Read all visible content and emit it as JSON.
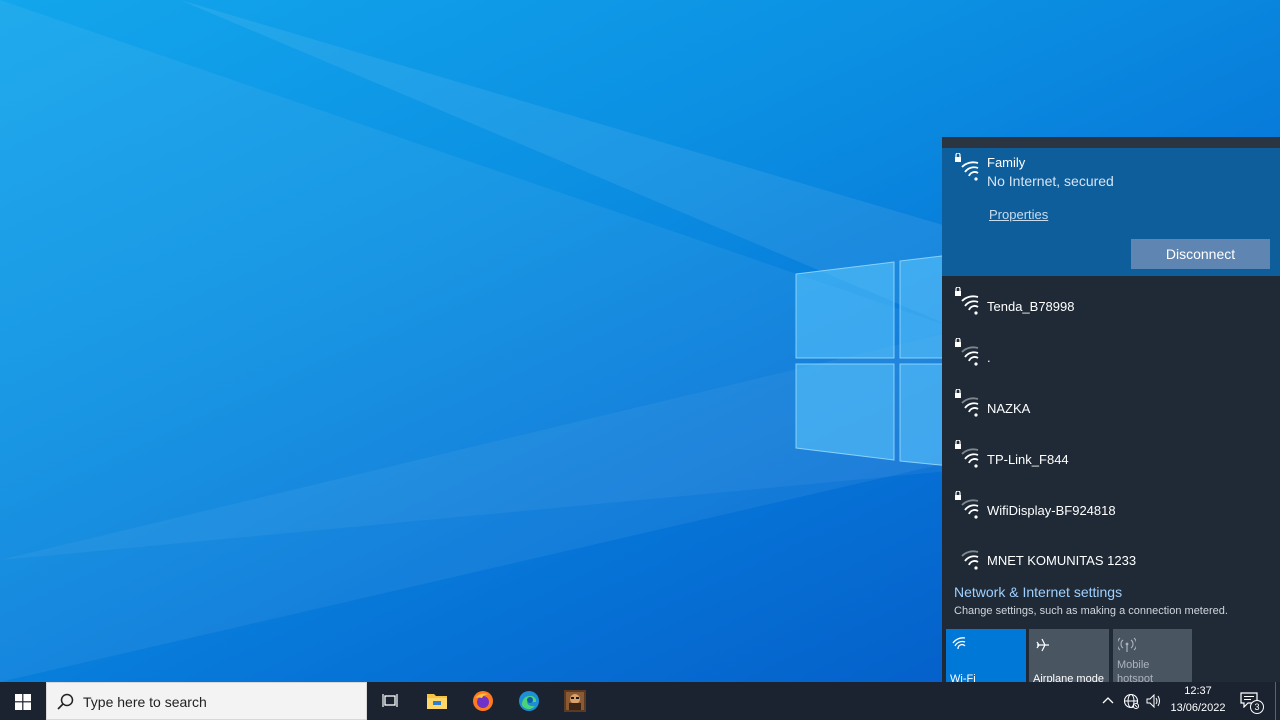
{
  "flyout": {
    "connected": {
      "name": "Family",
      "status": "No Internet, secured",
      "properties_label": "Properties",
      "disconnect_label": "Disconnect"
    },
    "networks": [
      {
        "name": "Tenda_B78998",
        "secured": true
      },
      {
        "name": ".",
        "secured": true
      },
      {
        "name": "NAZKA",
        "secured": true
      },
      {
        "name": "TP-Link_F844",
        "secured": true
      },
      {
        "name": "WifiDisplay-BF924818",
        "secured": true
      },
      {
        "name": "MNET KOMUNITAS 1233",
        "secured": false
      }
    ],
    "settings_link": "Network & Internet settings",
    "settings_desc": "Change settings, such as making a connection metered.",
    "quick_actions": [
      {
        "label": "Wi-Fi",
        "icon": "wifi-icon",
        "state": "on"
      },
      {
        "label": "Airplane mode",
        "icon": "airplane-icon",
        "state": "off"
      },
      {
        "label": "Mobile hotspot",
        "icon": "hotspot-icon",
        "state": "disabled"
      }
    ]
  },
  "taskbar": {
    "search_placeholder": "Type here to search",
    "pinned_icons": [
      "task-view-icon",
      "file-explorer-icon",
      "firefox-icon",
      "edge-icon",
      "game-app-icon"
    ],
    "clock": {
      "time": "12:37",
      "date": "13/06/2022"
    },
    "notification_count": "3"
  },
  "colors": {
    "accent": "#0078d7",
    "flyout_bg": "#1f2a36",
    "connected_bg": "#0f5e9c",
    "taskbar_bg": "#1b2330"
  }
}
